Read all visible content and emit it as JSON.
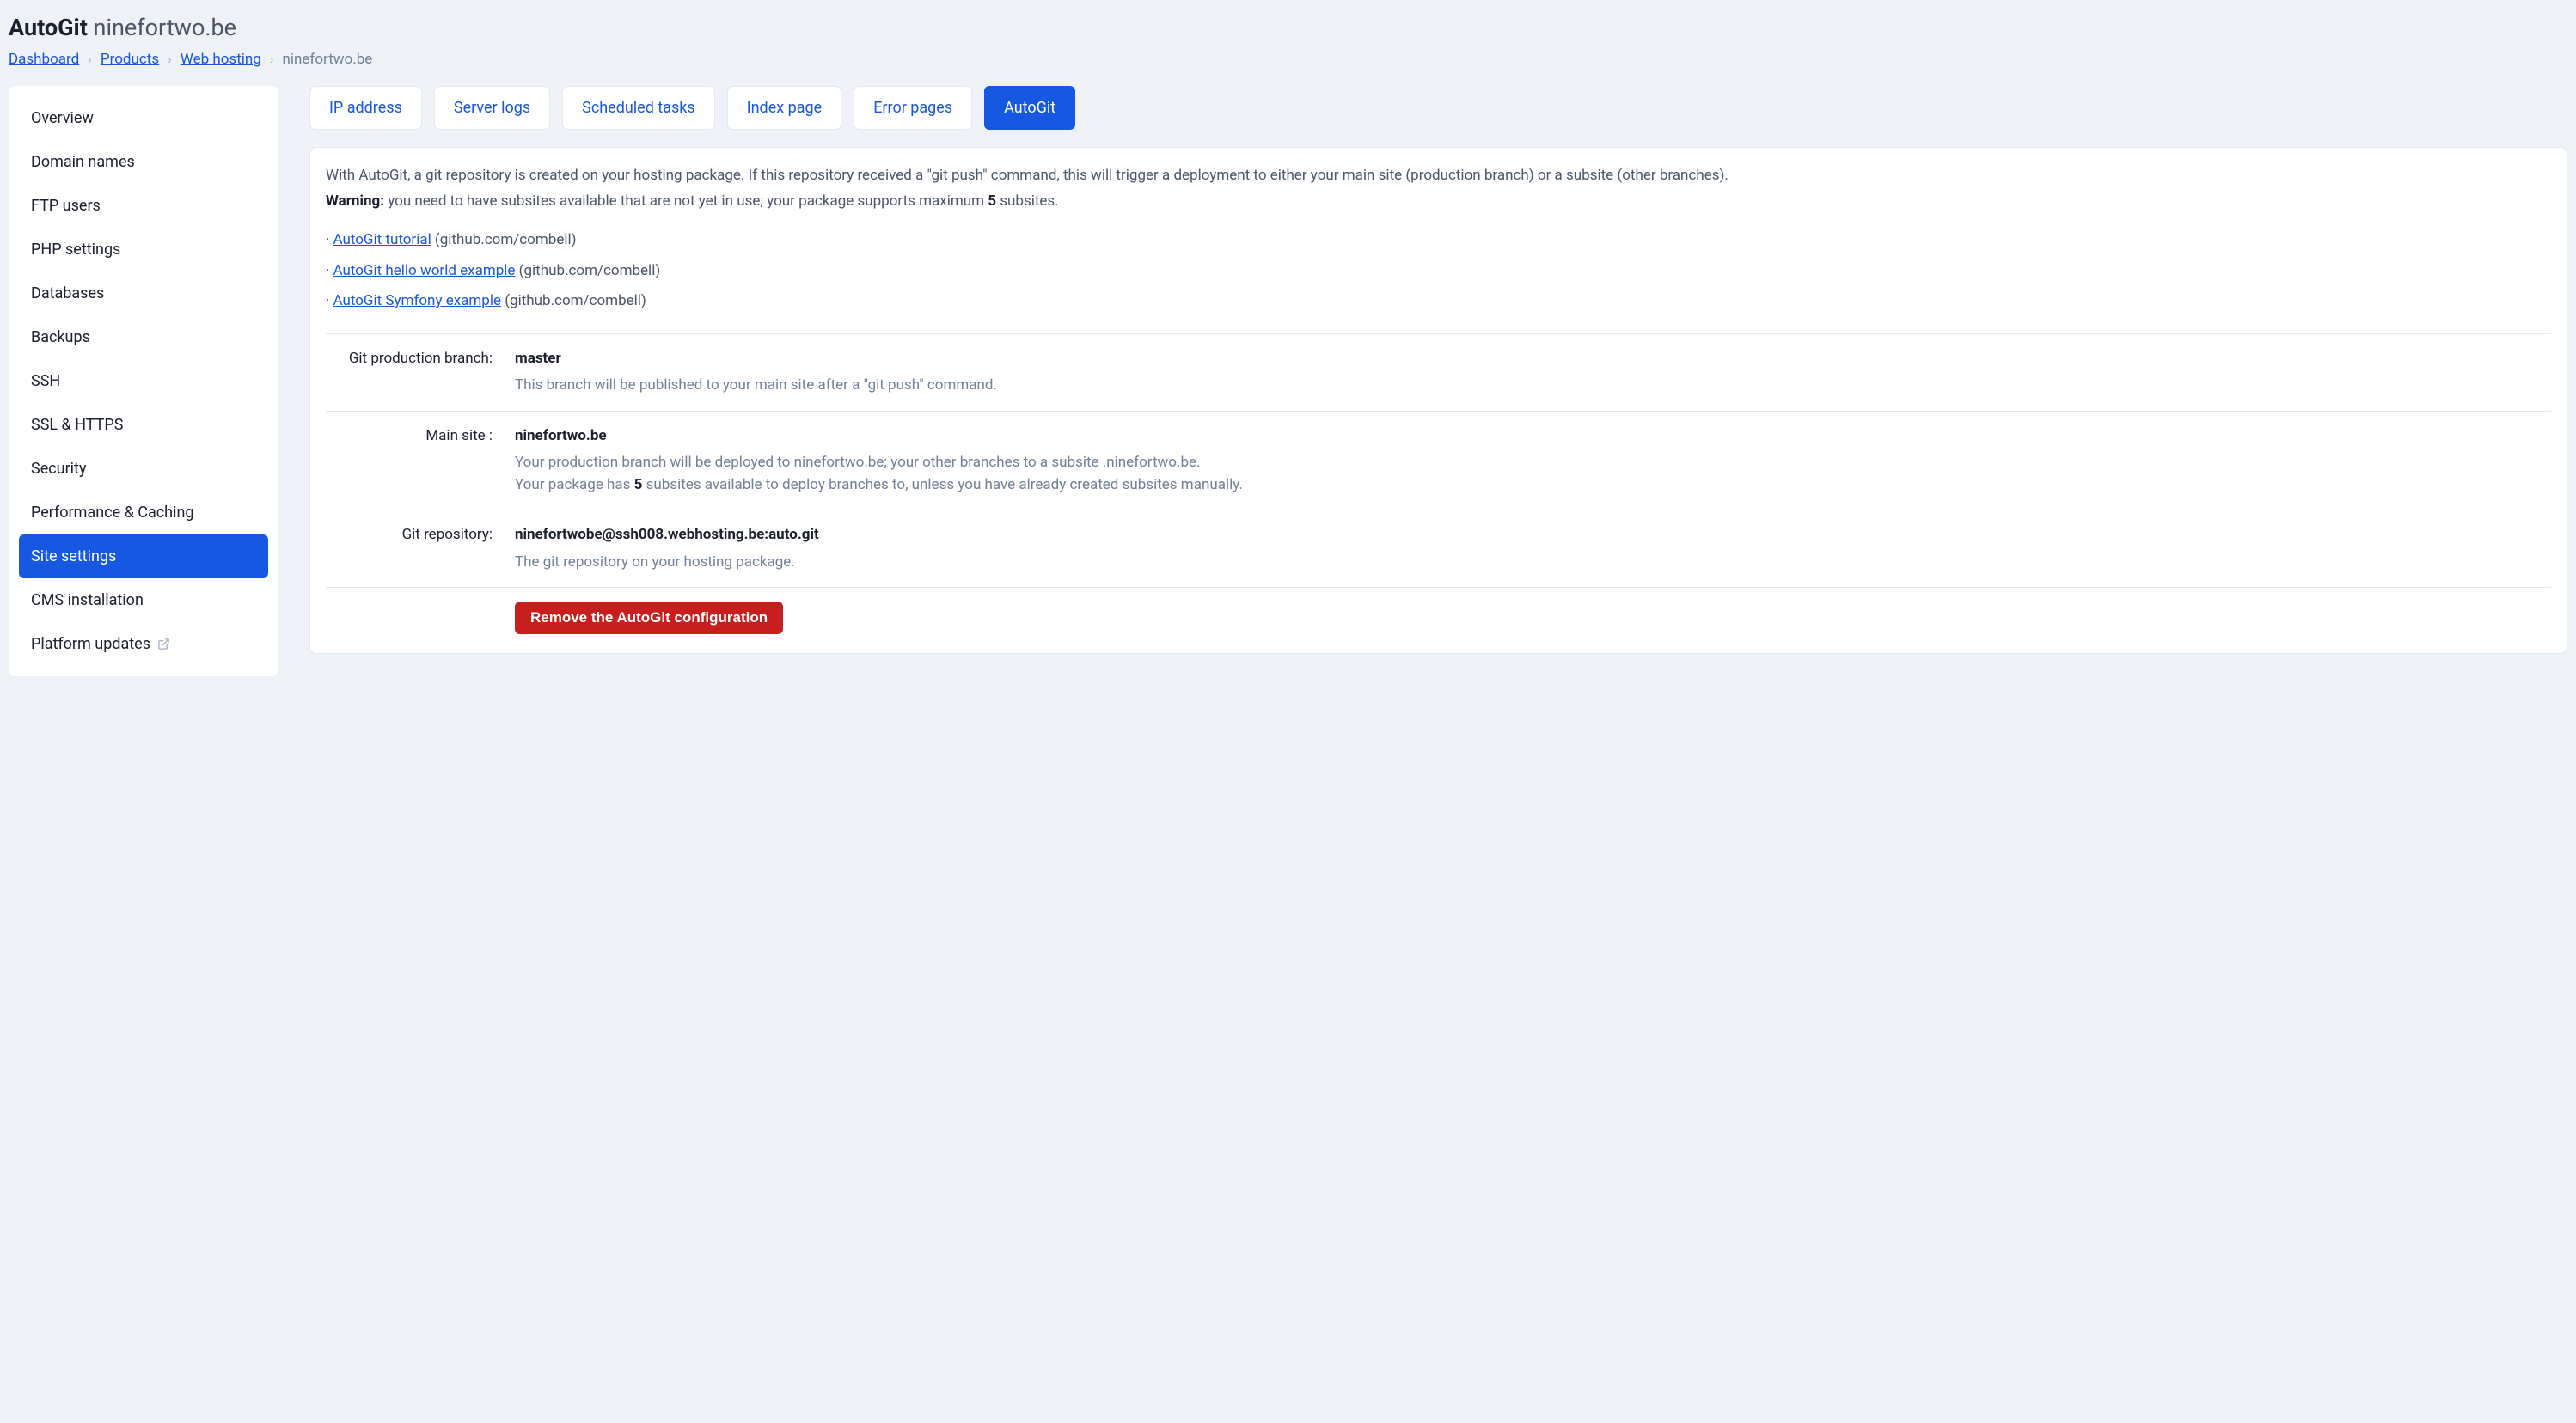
{
  "header": {
    "title_bold": "AutoGit",
    "title_light": "ninefortwo.be"
  },
  "breadcrumb": {
    "items": [
      {
        "label": "Dashboard",
        "link": true
      },
      {
        "label": "Products",
        "link": true
      },
      {
        "label": "Web hosting",
        "link": true
      },
      {
        "label": "ninefortwo.be",
        "link": false
      }
    ]
  },
  "sidebar": {
    "items": [
      {
        "label": "Overview",
        "active": false,
        "external": false
      },
      {
        "label": "Domain names",
        "active": false,
        "external": false
      },
      {
        "label": "FTP users",
        "active": false,
        "external": false
      },
      {
        "label": "PHP settings",
        "active": false,
        "external": false
      },
      {
        "label": "Databases",
        "active": false,
        "external": false
      },
      {
        "label": "Backups",
        "active": false,
        "external": false
      },
      {
        "label": "SSH",
        "active": false,
        "external": false
      },
      {
        "label": "SSL & HTTPS",
        "active": false,
        "external": false
      },
      {
        "label": "Security",
        "active": false,
        "external": false
      },
      {
        "label": "Performance & Caching",
        "active": false,
        "external": false
      },
      {
        "label": "Site settings",
        "active": true,
        "external": false
      },
      {
        "label": "CMS installation",
        "active": false,
        "external": false
      },
      {
        "label": "Platform updates",
        "active": false,
        "external": true
      }
    ]
  },
  "tabs": [
    {
      "label": "IP address",
      "active": false
    },
    {
      "label": "Server logs",
      "active": false
    },
    {
      "label": "Scheduled tasks",
      "active": false
    },
    {
      "label": "Index page",
      "active": false
    },
    {
      "label": "Error pages",
      "active": false
    },
    {
      "label": "AutoGit",
      "active": true
    }
  ],
  "intro": {
    "line1": "With AutoGit, a git repository is created on your hosting package. If this repository received a \"git push\" command, this will trigger a deployment to either your main site (production branch) or a subsite (other branches).",
    "warning_label": "Warning:",
    "warning_text_before": " you need to have subsites available that are not yet in use; your package supports maximum ",
    "warning_n": "5",
    "warning_text_after": " subsites."
  },
  "links": [
    {
      "text": "AutoGit tutorial",
      "suffix": " (github.com/combell)"
    },
    {
      "text": "AutoGit hello world example",
      "suffix": " (github.com/combell)"
    },
    {
      "text": "AutoGit Symfony example",
      "suffix": " (github.com/combell)"
    }
  ],
  "details": {
    "branch": {
      "label": "Git production branch:",
      "value": "master",
      "desc": "This branch will be published to your main site after a \"git push\" command."
    },
    "mainsite": {
      "label": "Main site :",
      "value": "ninefortwo.be",
      "desc1": "Your production branch will be deployed to ninefortwo.be; your other branches to a subsite .ninefortwo.be.",
      "desc2_before": "Your package has ",
      "desc2_n": "5",
      "desc2_after": " subsites available to deploy branches to, unless you have already created subsites manually."
    },
    "repo": {
      "label": "Git repository:",
      "value": "ninefortwobe@ssh008.webhosting.be:auto.git",
      "desc": "The git repository on your hosting package."
    }
  },
  "actions": {
    "remove_label": "Remove the AutoGit configuration"
  }
}
